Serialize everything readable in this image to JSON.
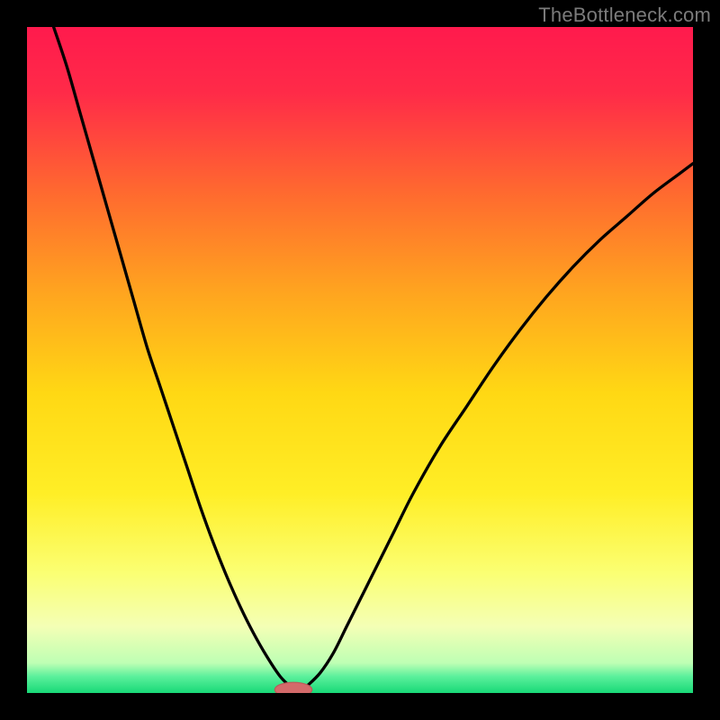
{
  "attribution": "TheBottleneck.com",
  "colors": {
    "frame": "#000000",
    "gradient_stops": [
      {
        "offset": 0.0,
        "color": "#ff1a4d"
      },
      {
        "offset": 0.1,
        "color": "#ff2b48"
      },
      {
        "offset": 0.25,
        "color": "#ff6a2f"
      },
      {
        "offset": 0.4,
        "color": "#ffa51f"
      },
      {
        "offset": 0.55,
        "color": "#ffd814"
      },
      {
        "offset": 0.7,
        "color": "#ffee26"
      },
      {
        "offset": 0.82,
        "color": "#fbff73"
      },
      {
        "offset": 0.9,
        "color": "#f4ffb5"
      },
      {
        "offset": 0.955,
        "color": "#beffb4"
      },
      {
        "offset": 0.975,
        "color": "#5cf09c"
      },
      {
        "offset": 1.0,
        "color": "#18d977"
      }
    ],
    "curve": "#000000",
    "marker_fill": "#d46a6a",
    "marker_stroke": "#bb5a5a"
  },
  "chart_data": {
    "type": "line",
    "title": "",
    "xlabel": "",
    "ylabel": "",
    "xlim": [
      0,
      100
    ],
    "ylim": [
      0,
      100
    ],
    "minimum_x": 40,
    "series": [
      {
        "name": "left-branch",
        "x": [
          4,
          6,
          8,
          10,
          12,
          14,
          16,
          18,
          20,
          22,
          24,
          26,
          28,
          30,
          32,
          34,
          36,
          38,
          40
        ],
        "y": [
          100,
          94,
          87,
          80,
          73,
          66,
          59,
          52,
          46,
          40,
          34,
          28,
          22.5,
          17.5,
          13,
          9,
          5.5,
          2.5,
          0.5
        ]
      },
      {
        "name": "right-branch",
        "x": [
          42,
          44,
          46,
          48,
          50,
          52,
          55,
          58,
          62,
          66,
          70,
          74,
          78,
          82,
          86,
          90,
          94,
          98,
          100
        ],
        "y": [
          1,
          3,
          6,
          10,
          14,
          18,
          24,
          30,
          37,
          43,
          49,
          54.5,
          59.5,
          64,
          68,
          71.5,
          75,
          78,
          79.5
        ]
      }
    ],
    "marker": {
      "x": 40,
      "y": 0.5,
      "rx": 2.8,
      "ry": 1.1
    }
  }
}
